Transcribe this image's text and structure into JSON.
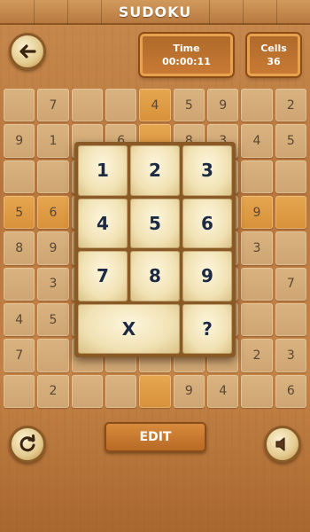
{
  "header": {
    "title": "SUDOKU"
  },
  "info": {
    "time_label": "Time",
    "time_value": "00:00:11",
    "cells_label": "Cells",
    "cells_value": "36"
  },
  "icons": {
    "back": "back-arrow-icon",
    "refresh": "refresh-icon",
    "sound": "speaker-icon"
  },
  "colors": {
    "highlight": "#e6a650",
    "cell": "#d9b380",
    "picker_text": "#1c2a44"
  },
  "grid": [
    [
      "",
      "7",
      "",
      "",
      "4",
      "5",
      "9",
      "",
      "2"
    ],
    [
      "9",
      "1",
      "",
      "6",
      "",
      "8",
      "3",
      "4",
      "5"
    ],
    [
      "",
      "",
      "",
      "",
      "",
      "",
      "",
      "",
      ""
    ],
    [
      "5",
      "6",
      "",
      "",
      "",
      "",
      "",
      "9",
      ""
    ],
    [
      "8",
      "9",
      "",
      "",
      "",
      "",
      "",
      "3",
      ""
    ],
    [
      "",
      "3",
      "",
      "",
      "",
      "",
      "",
      "",
      "7"
    ],
    [
      "4",
      "5",
      "",
      "",
      "",
      "",
      "",
      "",
      ""
    ],
    [
      "7",
      "",
      "",
      "",
      "",
      "",
      "",
      "2",
      "3"
    ],
    [
      "",
      "2",
      "",
      "",
      "",
      "9",
      "4",
      "",
      "6"
    ]
  ],
  "highlight": [
    [
      0,
      4
    ],
    [
      1,
      4
    ],
    [
      3,
      0
    ],
    [
      3,
      1
    ],
    [
      3,
      7
    ],
    [
      3,
      8
    ],
    [
      8,
      4
    ]
  ],
  "picker": {
    "keys": [
      "1",
      "2",
      "3",
      "4",
      "5",
      "6",
      "7",
      "8",
      "9"
    ],
    "clear": "X",
    "hint": "?"
  },
  "footer": {
    "edit_label": "EDIT"
  }
}
